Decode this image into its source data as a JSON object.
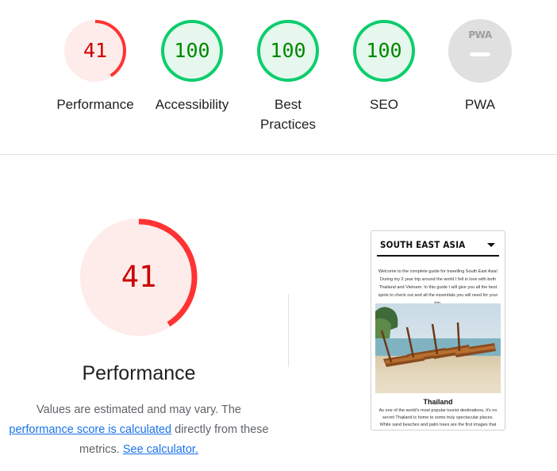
{
  "summary": {
    "gauges": [
      {
        "score": "41",
        "label": "Performance",
        "value": 41,
        "rating": "fail"
      },
      {
        "score": "100",
        "label": "Accessibility",
        "value": 100,
        "rating": "pass"
      },
      {
        "score": "100",
        "label": "Best Practices",
        "value": 100,
        "rating": "pass"
      },
      {
        "score": "100",
        "label": "SEO",
        "value": 100,
        "rating": "pass"
      }
    ],
    "pwa": {
      "badge_text": "PWA",
      "label": "PWA"
    }
  },
  "performance": {
    "score": "41",
    "value": 41,
    "label": "Performance",
    "desc_part1": "Values are estimated and may vary. The",
    "link_score": "performance score is calculated",
    "desc_part2": "directly from these metrics.",
    "link_calc": "See calculator."
  },
  "screenshot": {
    "header_title": "SOUTH EAST ASIA",
    "intro": "Welcome to the complete guide for travelling South East Asia! During my 2 year trip around the world I fell in love with both Thailand and Vietnam. In this guide I will give you all the best spots to check out and all the essentials you will need for your trip.",
    "heading": "Thailand",
    "body": "As one of the world's most popular tourist destinations, it's no secret Thailand is home to some truly spectacular places. White sand beaches and palm trees are the first images that come to mind."
  },
  "colors": {
    "pass": "#0cce6b",
    "pass_fill": "#e6f7ed",
    "fail": "#ff3333",
    "fail_fill": "#fdecea",
    "neutral": "#e0e0e0"
  }
}
